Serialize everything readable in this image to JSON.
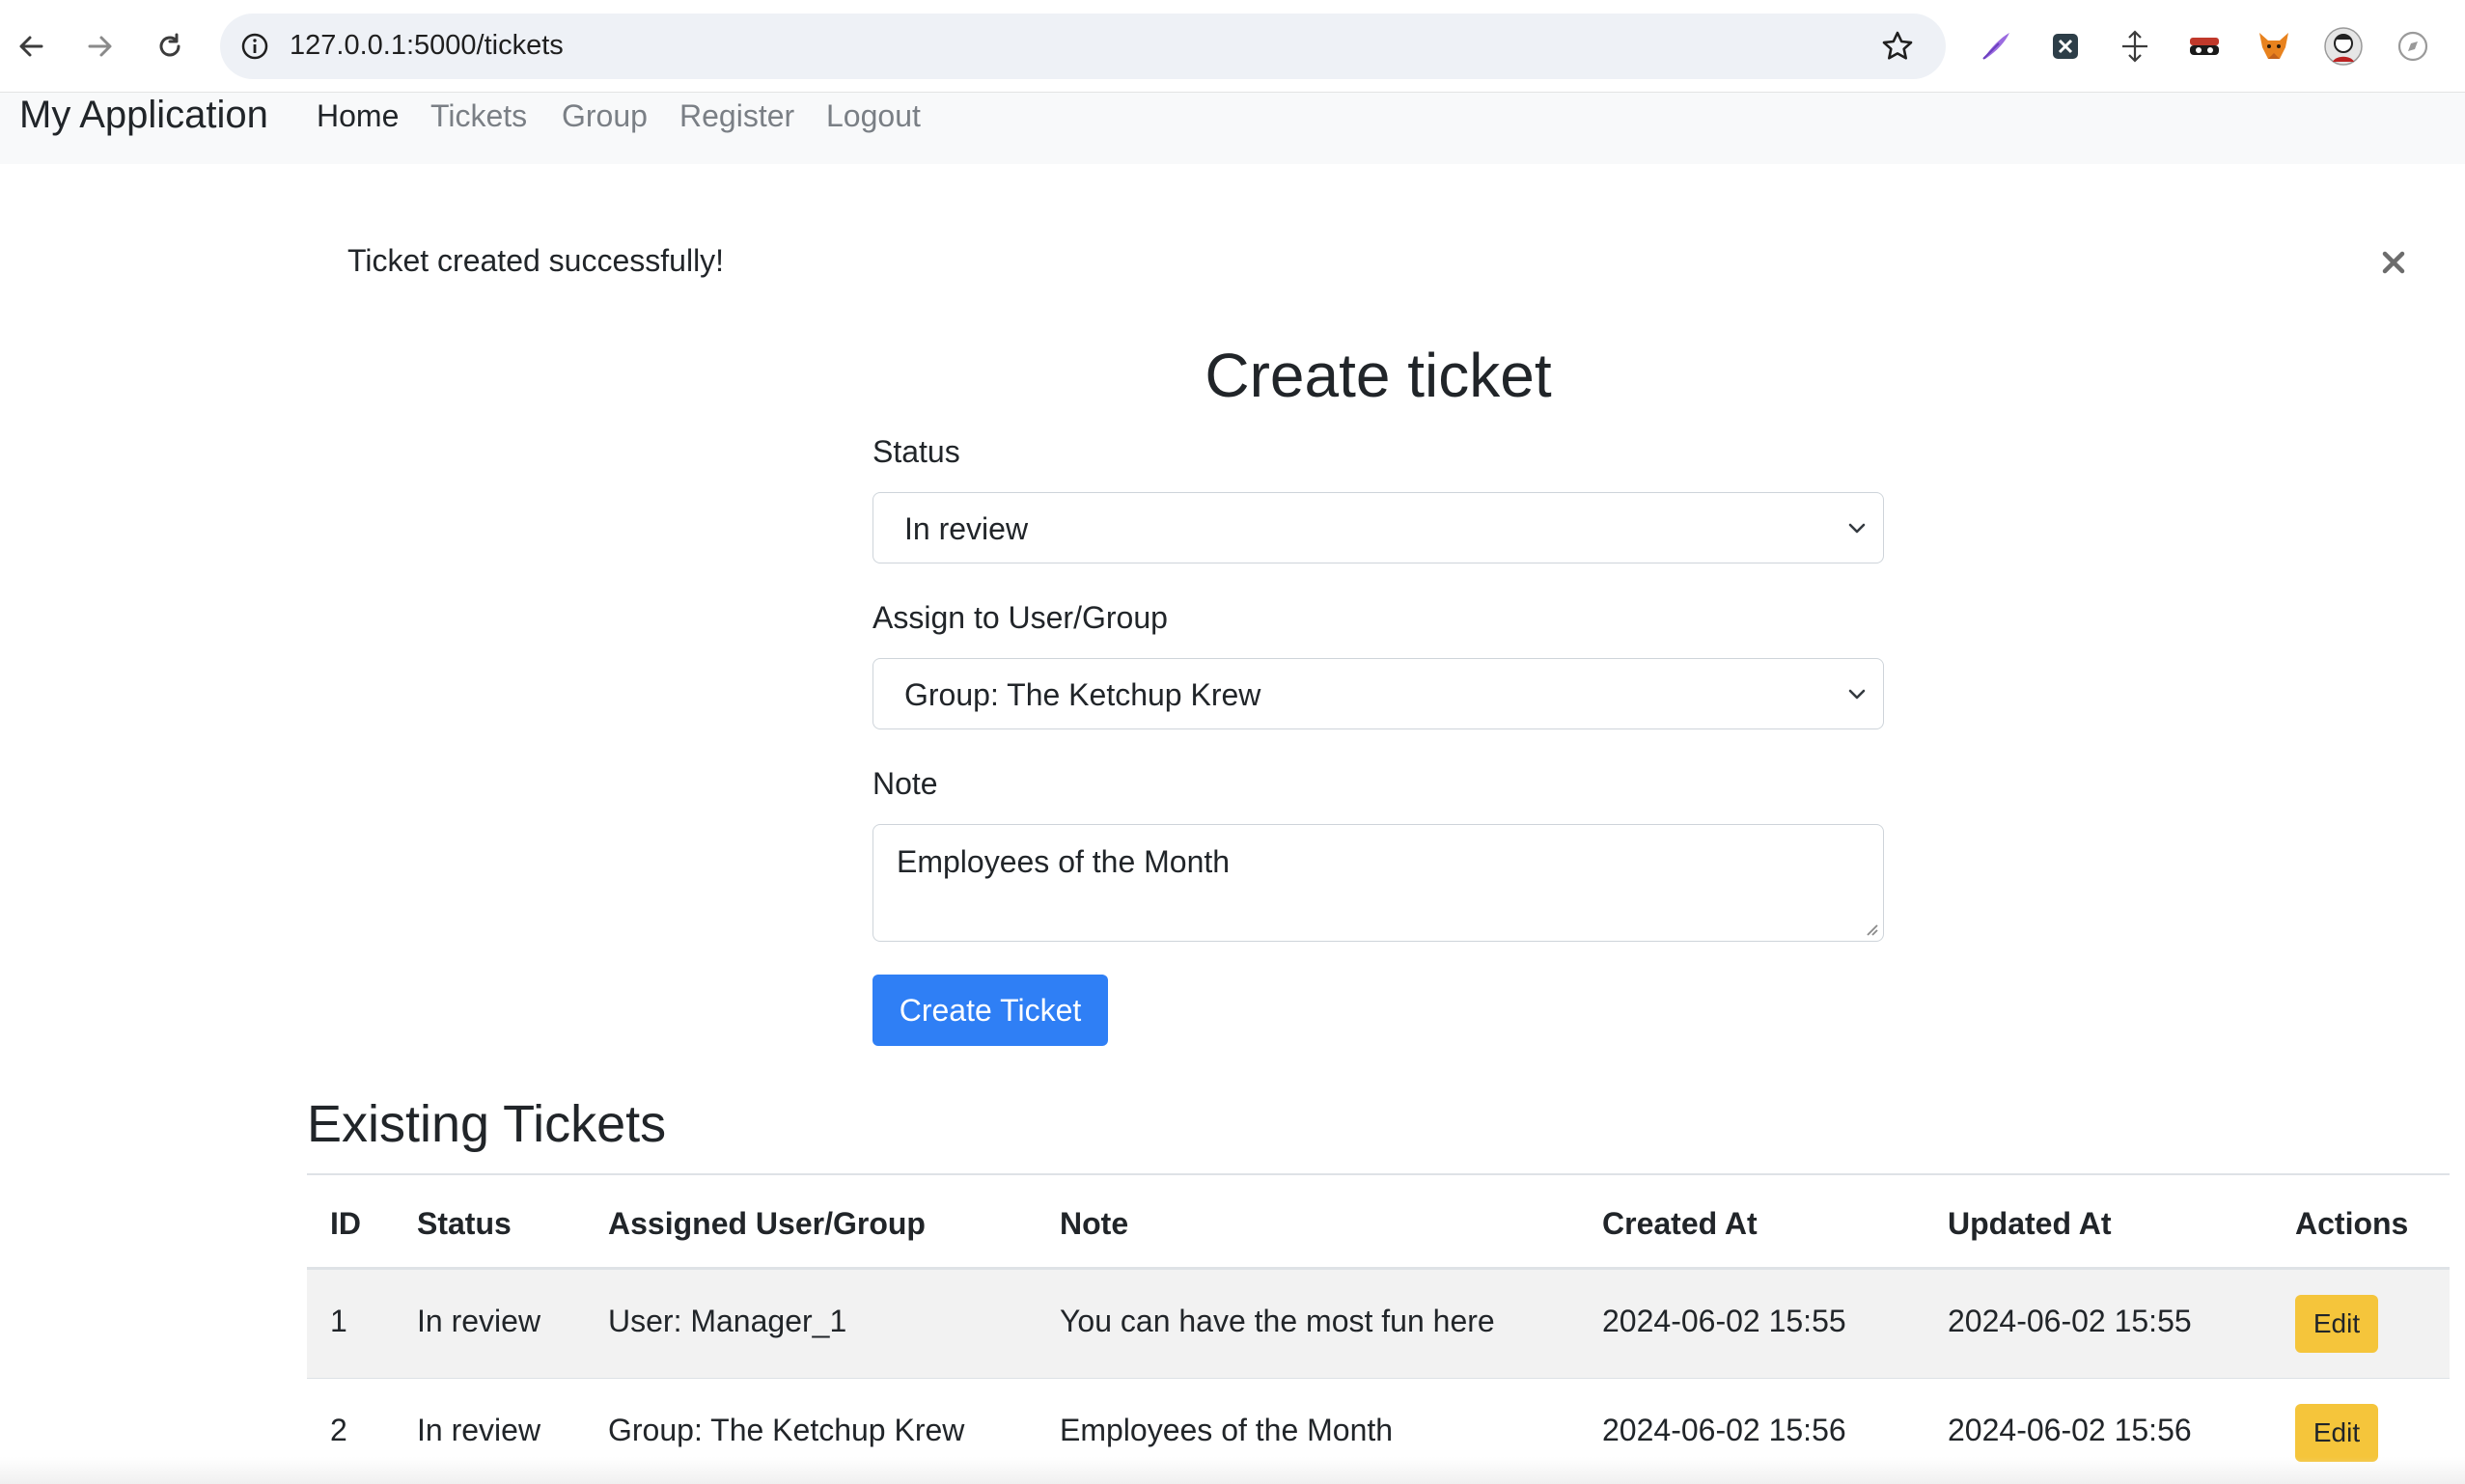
{
  "browser": {
    "url": "127.0.0.1:5000/tickets",
    "icons": [
      "back-arrow-icon",
      "forward-arrow-icon",
      "reload-icon",
      "site-info-icon",
      "bookmark-star-icon"
    ],
    "extensions": [
      "feather-pen-extension-icon",
      "x-extension-icon",
      "move-arrows-extension-icon",
      "mask-extension-icon",
      "fox-extension-icon",
      "profile-avatar-icon",
      "compass-extension-icon"
    ]
  },
  "navbar": {
    "brand": "My Application",
    "links": [
      {
        "label": "Home",
        "active": true
      },
      {
        "label": "Tickets",
        "active": false
      },
      {
        "label": "Group",
        "active": false
      },
      {
        "label": "Register",
        "active": false
      },
      {
        "label": "Logout",
        "active": false
      }
    ]
  },
  "alert": {
    "message": "Ticket created successfully!",
    "close_symbol": "×"
  },
  "form": {
    "title": "Create ticket",
    "status_label": "Status",
    "status_value": "In review",
    "assign_label": "Assign to User/Group",
    "assign_value": "Group: The Ketchup Krew",
    "note_label": "Note",
    "note_value": "Employees of the Month",
    "submit_label": "Create Ticket"
  },
  "tickets": {
    "title": "Existing Tickets",
    "columns": [
      "ID",
      "Status",
      "Assigned User/Group",
      "Note",
      "Created At",
      "Updated At",
      "Actions"
    ],
    "rows": [
      {
        "id": "1",
        "status": "In review",
        "assigned": "User: Manager_1",
        "note": "You can have the most fun here",
        "created": "2024-06-02 15:55",
        "updated": "2024-06-02 15:55",
        "action": "Edit"
      },
      {
        "id": "2",
        "status": "In review",
        "assigned": "Group: The Ketchup Krew",
        "note": "Employees of the Month",
        "created": "2024-06-02 15:56",
        "updated": "2024-06-02 15:56",
        "action": "Edit"
      }
    ]
  },
  "colors": {
    "primary": "#2f7ff5",
    "warning": "#f5c53b",
    "navbar_bg": "#f8f9fa",
    "muted_link": "#7a7f85"
  }
}
